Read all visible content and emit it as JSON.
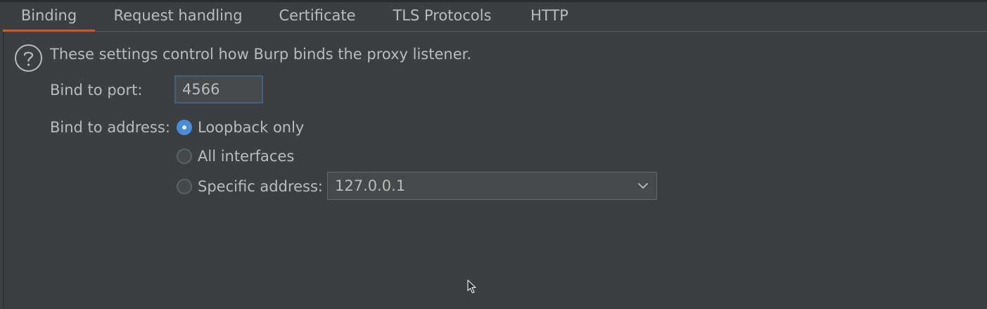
{
  "tabs": [
    {
      "label": "Binding",
      "active": true
    },
    {
      "label": "Request handling",
      "active": false
    },
    {
      "label": "Certificate",
      "active": false
    },
    {
      "label": "TLS Protocols",
      "active": false
    },
    {
      "label": "HTTP",
      "active": false
    }
  ],
  "intro": "These settings control how Burp binds the proxy listener.",
  "port": {
    "label": "Bind to port:",
    "value": "4566"
  },
  "address": {
    "label": "Bind to address:",
    "options": [
      {
        "label": "Loopback only",
        "checked": true
      },
      {
        "label": "All interfaces",
        "checked": false
      },
      {
        "label": "Specific address:",
        "checked": false
      }
    ],
    "specific_value": "127.0.0.1"
  },
  "icons": {
    "help": "question-circle-icon",
    "dropdown": "chevron-down-icon",
    "cursor": "mouse-pointer-icon"
  },
  "colors": {
    "background": "#3c3f41",
    "text": "#bbbbbb",
    "active_tab_underline": "#d05a2c",
    "radio_checked": "#4b8cd6"
  }
}
